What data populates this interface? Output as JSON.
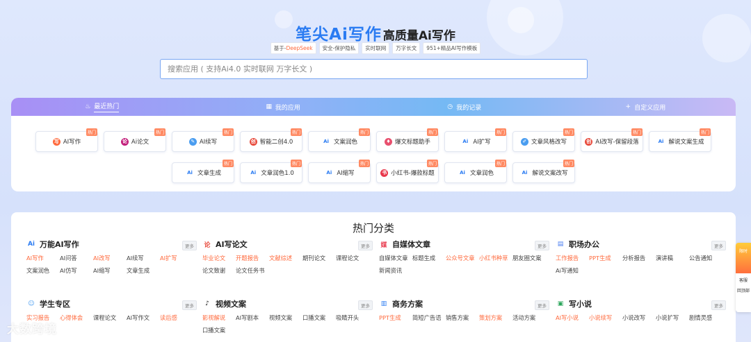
{
  "header": {
    "brand": "笔尖Ai写作",
    "subtitle": "高质量Ai写作",
    "tags": [
      {
        "prefix": "基于-",
        "highlight": "DeepSeek"
      },
      {
        "prefix": "安全-保护隐私",
        "highlight": ""
      },
      {
        "prefix": "实时联网",
        "highlight": ""
      },
      {
        "prefix": "万字长文",
        "highlight": ""
      },
      {
        "prefix": "951+精品AI写作模板",
        "highlight": ""
      }
    ]
  },
  "search": {
    "placeholder": "搜索应用 ( 支持Ai4.0 实时联网 万字长文 )"
  },
  "tabs": [
    {
      "label": "最近热门",
      "icon": "fire-icon"
    },
    {
      "label": "我的应用",
      "icon": "grid-icon"
    },
    {
      "label": "我的记录",
      "icon": "clock-icon"
    },
    {
      "label": "自定义应用",
      "icon": "plus-icon"
    }
  ],
  "hot_badge": "热门",
  "apps_row1": [
    {
      "label": "AI写作",
      "icon": "write-icon",
      "color": "#ff6a3d"
    },
    {
      "label": "Ai论文",
      "icon": "paper-icon",
      "color": "#c21d7a"
    },
    {
      "label": "AI续写",
      "icon": "pen-icon",
      "color": "#4a9df0"
    },
    {
      "label": "智能二创4.0",
      "icon": "rewrite-icon",
      "color": "#e84a3c"
    },
    {
      "label": "文案润色",
      "icon": "ai-icon",
      "color": "#2a7bf2"
    },
    {
      "label": "爆文标题助手",
      "icon": "title-icon",
      "color": "#e8506e"
    },
    {
      "label": "AI扩写",
      "icon": "ai-icon",
      "color": "#2a7bf2"
    },
    {
      "label": "文章风格改写",
      "icon": "style-icon",
      "color": "#4a9df0"
    },
    {
      "label": "AI改写-保留段落",
      "icon": "rewrite-icon",
      "color": "#e84a3c"
    },
    {
      "label": "解说文案生成",
      "icon": "ai-icon",
      "color": "#2a7bf2"
    }
  ],
  "apps_row2": [
    {
      "label": "文章生成",
      "icon": "ai-icon",
      "color": "#2a7bf2"
    },
    {
      "label": "文章润色1.0",
      "icon": "ai-icon",
      "color": "#2a7bf2"
    },
    {
      "label": "AI缩写",
      "icon": "ai-icon",
      "color": "#2a7bf2"
    },
    {
      "label": "小红书-爆款标题",
      "icon": "xiaohongshu-icon",
      "color": "#e8364a"
    },
    {
      "label": "文章润色",
      "icon": "ai-icon",
      "color": "#2a7bf2"
    },
    {
      "label": "解说文案改写",
      "icon": "ai-icon",
      "color": "#2a7bf2"
    }
  ],
  "categories_title": "热门分类",
  "more_label": "更多",
  "categories": [
    {
      "name": "万能AI写作",
      "icon": "ai-icon",
      "items": [
        {
          "t": "AI写作",
          "hl": true
        },
        {
          "t": "AI问答",
          "hl": false
        },
        {
          "t": "AI改写",
          "hl": true
        },
        {
          "t": "AI续写",
          "hl": false
        },
        {
          "t": "AI扩写",
          "hl": true
        },
        {
          "t": "文案润色",
          "hl": false
        },
        {
          "t": "AI仿写",
          "hl": false
        },
        {
          "t": "AI缩写",
          "hl": false
        },
        {
          "t": "文章生成",
          "hl": false
        }
      ]
    },
    {
      "name": "AI写论文",
      "icon": "paper-icon",
      "items": [
        {
          "t": "毕业论文",
          "hl": true
        },
        {
          "t": "开题报告",
          "hl": true
        },
        {
          "t": "文献综述",
          "hl": true
        },
        {
          "t": "期刊论文",
          "hl": false
        },
        {
          "t": "课程论文",
          "hl": false
        },
        {
          "t": "论文致谢",
          "hl": false
        },
        {
          "t": "论文任务书",
          "hl": false
        }
      ]
    },
    {
      "name": "自媒体文章",
      "icon": "media-icon",
      "items": [
        {
          "t": "自媒体文章",
          "hl": false
        },
        {
          "t": "标题生成",
          "hl": false
        },
        {
          "t": "公众号文章",
          "hl": true
        },
        {
          "t": "小红书种草",
          "hl": true
        },
        {
          "t": "朋友圈文案",
          "hl": false
        },
        {
          "t": "新闻资讯",
          "hl": false
        }
      ]
    },
    {
      "name": "职场办公",
      "icon": "briefcase-icon",
      "items": [
        {
          "t": "工作报告",
          "hl": true
        },
        {
          "t": "PPT生成",
          "hl": true
        },
        {
          "t": "分析报告",
          "hl": false
        },
        {
          "t": "演讲稿",
          "hl": false
        },
        {
          "t": "公告通知",
          "hl": false
        },
        {
          "t": "Ai写通知",
          "hl": false
        }
      ]
    },
    {
      "name": "学生专区",
      "icon": "student-icon",
      "items": [
        {
          "t": "实习报告",
          "hl": true
        },
        {
          "t": "心得体会",
          "hl": true
        },
        {
          "t": "课程论文",
          "hl": false
        },
        {
          "t": "AI写作文",
          "hl": false
        },
        {
          "t": "读后感",
          "hl": true
        }
      ]
    },
    {
      "name": "视频文案",
      "icon": "tiktok-icon",
      "items": [
        {
          "t": "影视解说",
          "hl": true
        },
        {
          "t": "AI写剧本",
          "hl": false
        },
        {
          "t": "视频文案",
          "hl": false
        },
        {
          "t": "口播文案",
          "hl": false
        },
        {
          "t": "吸睛开头",
          "hl": false
        },
        {
          "t": "口播文案",
          "hl": false
        }
      ]
    },
    {
      "name": "商务方案",
      "icon": "chart-icon",
      "items": [
        {
          "t": "PPT生成",
          "hl": true
        },
        {
          "t": "简短广告语",
          "hl": false
        },
        {
          "t": "销售方案",
          "hl": false
        },
        {
          "t": "策划方案",
          "hl": true
        },
        {
          "t": "活动方案",
          "hl": false
        }
      ]
    },
    {
      "name": "写小说",
      "icon": "book-icon",
      "items": [
        {
          "t": "AI写小说",
          "hl": true
        },
        {
          "t": "小说续写",
          "hl": true
        },
        {
          "t": "小说改写",
          "hl": false
        },
        {
          "t": "小说扩写",
          "hl": false
        },
        {
          "t": "剧情灵感",
          "hl": false
        }
      ]
    }
  ],
  "side_widget": {
    "promo": "限时",
    "service": "客服",
    "top": "回顶部"
  },
  "watermark": "大数跨境"
}
